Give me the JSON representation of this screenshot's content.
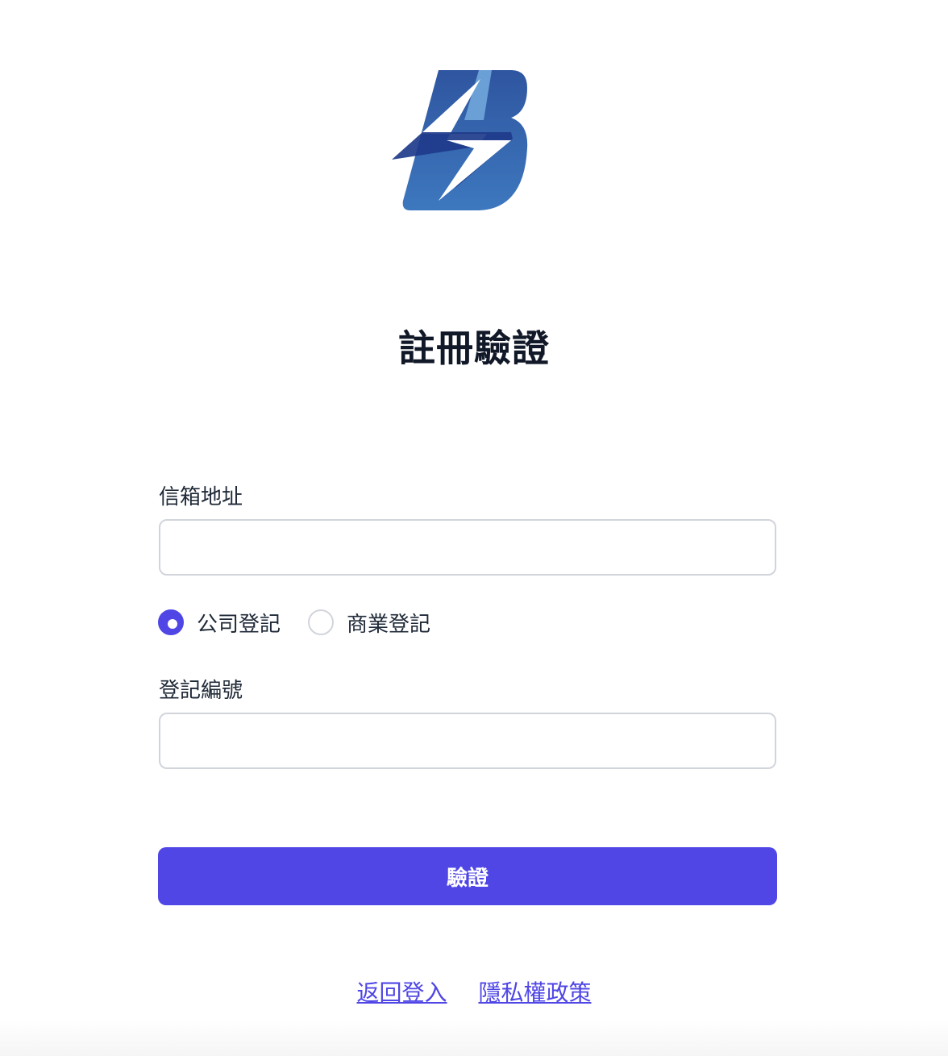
{
  "logo": {
    "name": "lightning-b-logo",
    "colors": {
      "dark": "#2d4f9a",
      "mid": "#3a6fb8",
      "accent": "#6aa0d6",
      "bolt": "#1e3b8a"
    }
  },
  "title": "註冊驗證",
  "email": {
    "label": "信箱地址",
    "value": "",
    "placeholder": ""
  },
  "registration_type": {
    "options": [
      {
        "label": "公司登記",
        "checked": true
      },
      {
        "label": "商業登記",
        "checked": false
      }
    ]
  },
  "registration_number": {
    "label": "登記編號",
    "value": "",
    "placeholder": ""
  },
  "submit_label": "驗證",
  "links": {
    "back_to_login": "返回登入",
    "privacy_policy": "隱私權政策"
  },
  "colors": {
    "primary": "#4f46e5",
    "border": "#d1d5db"
  }
}
